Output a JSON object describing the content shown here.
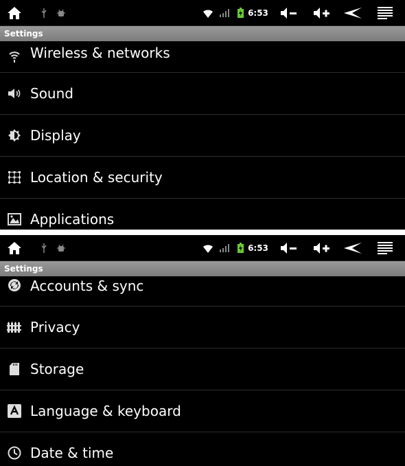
{
  "screens": [
    {
      "status": {
        "time": "6:53"
      },
      "title": "Settings",
      "items": [
        {
          "label": "Wireless & networks",
          "icon": "wifi-icon"
        },
        {
          "label": "Sound",
          "icon": "speaker-icon"
        },
        {
          "label": "Display",
          "icon": "brightness-icon"
        },
        {
          "label": "Location & security",
          "icon": "location-grid-icon"
        },
        {
          "label": "Applications",
          "icon": "applications-icon"
        }
      ]
    },
    {
      "status": {
        "time": "6:53"
      },
      "title": "Settings",
      "items": [
        {
          "label": "Accounts & sync",
          "icon": "sync-icon"
        },
        {
          "label": "Privacy",
          "icon": "privacy-icon"
        },
        {
          "label": "Storage",
          "icon": "sdcard-icon"
        },
        {
          "label": "Language & keyboard",
          "icon": "keyboard-icon"
        },
        {
          "label": "Date & time",
          "icon": "clock-icon"
        }
      ]
    }
  ]
}
